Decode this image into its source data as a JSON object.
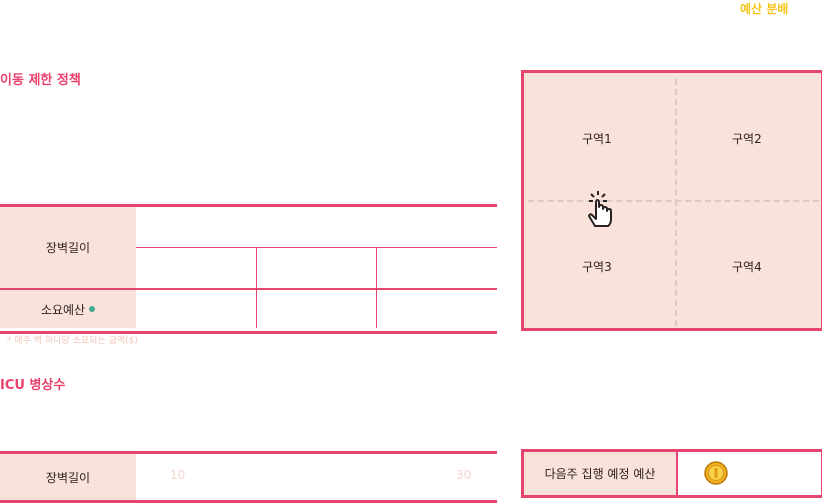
{
  "header": {
    "budget_button_label": "예산 분배"
  },
  "movement_policy": {
    "title": "이동 제한 정책",
    "wall_length_label": "장벽길이",
    "cost_label": "소요예산",
    "note": "* 매주 벽 하나당 소요되는 금액($)"
  },
  "zones": {
    "items": [
      {
        "label": "구역1"
      },
      {
        "label": "구역2"
      },
      {
        "label": "구역3"
      },
      {
        "label": "구역4"
      }
    ]
  },
  "icu": {
    "title": "ICU 병상수",
    "row_label": "장벽길이",
    "slider_min": "10",
    "slider_max": "30"
  },
  "budget": {
    "label": "다음주 집행 예정 예산"
  },
  "colors": {
    "accent": "#e5456f",
    "header_bg": "#f8e2d9",
    "yellow": "#f7c51c",
    "green_dot": "#3faa8f"
  }
}
